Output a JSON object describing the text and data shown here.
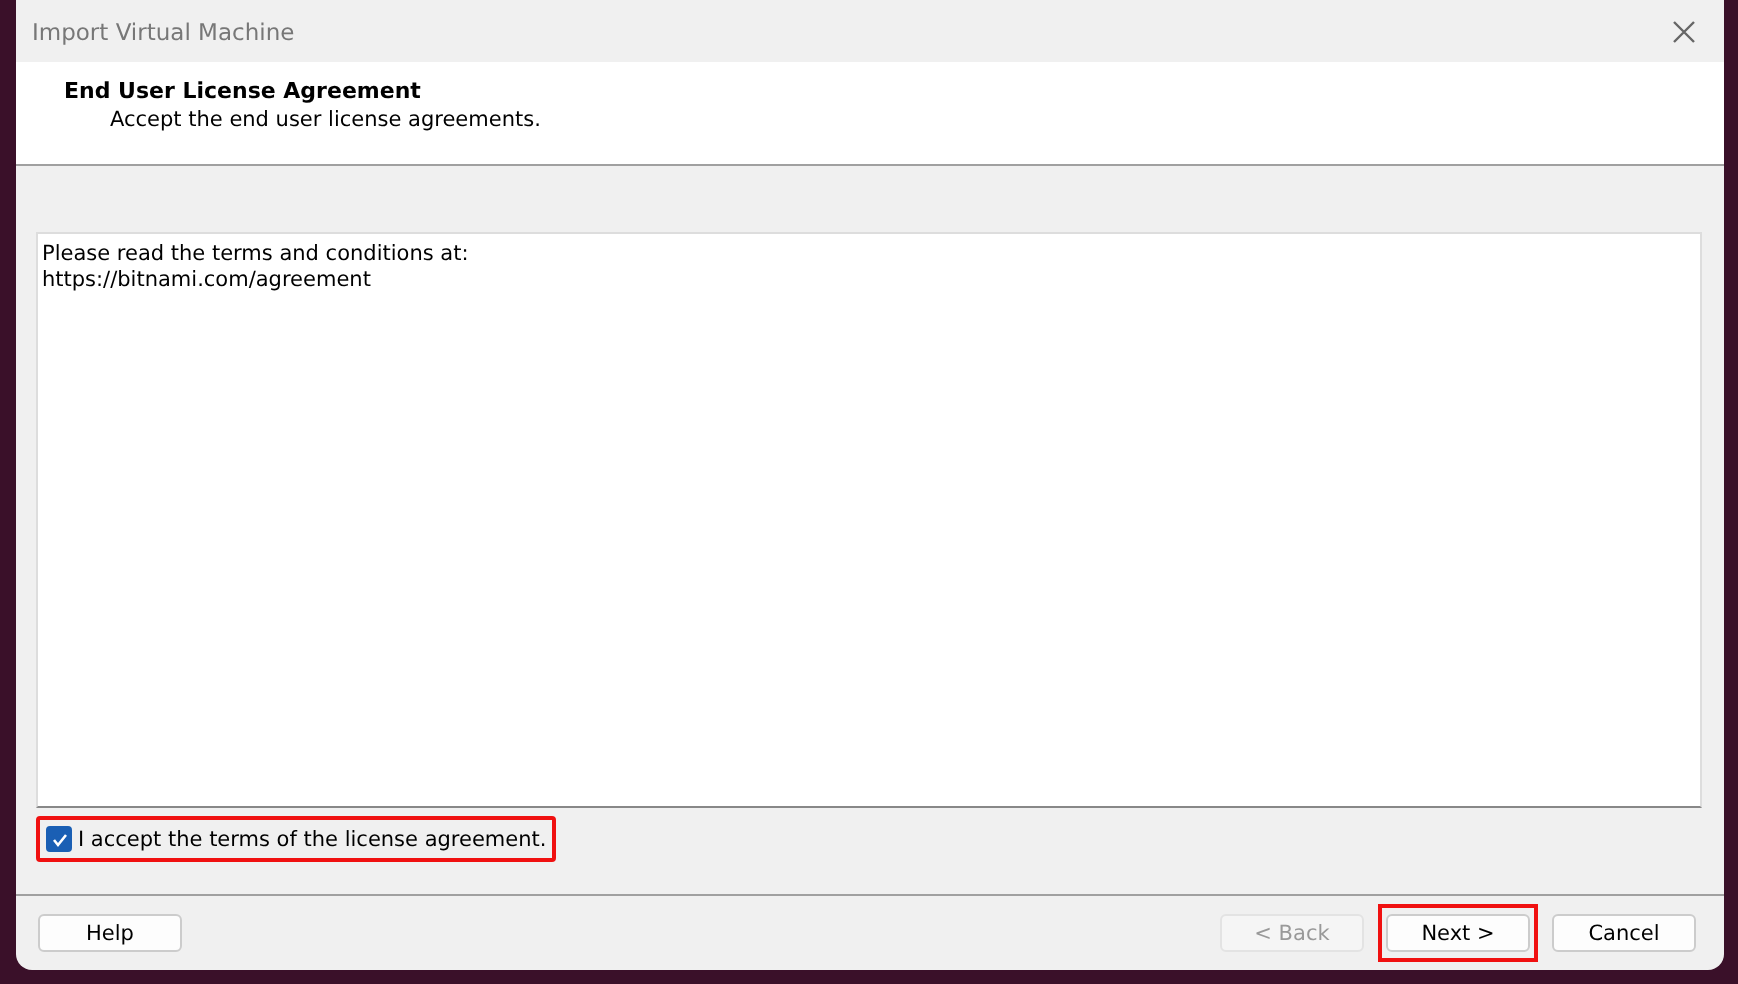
{
  "window": {
    "title": "Import Virtual Machine"
  },
  "header": {
    "title": "End User License Agreement",
    "subtitle": "Accept the end user license agreements."
  },
  "license_text": [
    "Please read the terms and conditions at:",
    "https://bitnami.com/agreement"
  ],
  "accept": {
    "label": "I accept the terms of the license agreement.",
    "checked": true,
    "highlighted": true
  },
  "buttons": [
    {
      "label": "Help",
      "disabled": false,
      "highlighted": false
    },
    {
      "label": "< Back",
      "disabled": true,
      "highlighted": false
    },
    {
      "label": "Next >",
      "disabled": false,
      "highlighted": true
    },
    {
      "label": "Cancel",
      "disabled": false,
      "highlighted": false
    }
  ]
}
